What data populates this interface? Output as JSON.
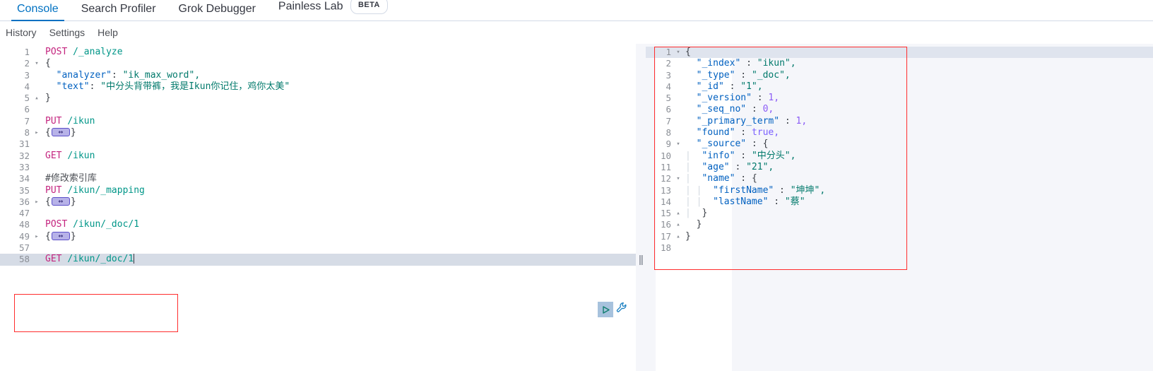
{
  "tabs": [
    {
      "label": "Console",
      "active": true,
      "badge": null
    },
    {
      "label": "Search Profiler",
      "active": false,
      "badge": null
    },
    {
      "label": "Grok Debugger",
      "active": false,
      "badge": null
    },
    {
      "label": "Painless Lab",
      "active": false,
      "badge": "BETA"
    }
  ],
  "subnav": [
    {
      "label": "History"
    },
    {
      "label": "Settings"
    },
    {
      "label": "Help"
    }
  ],
  "actions": {
    "run_icon": "play-triangle-icon",
    "wrench_icon": "wrench-icon",
    "splitter_grip": "||"
  },
  "colors": {
    "accent": "#0071c2",
    "annotation": "#ff2d2d",
    "method": "#c4257f",
    "url": "#009688",
    "key": "#0060c0",
    "string": "#00796b",
    "number": "#8b5cf6",
    "boolean": "#7b61ff"
  },
  "request_editor": {
    "lines": [
      {
        "num": "1",
        "fold": "",
        "highlight": false
      },
      {
        "num": "2",
        "fold": "▾",
        "highlight": false
      },
      {
        "num": "3",
        "fold": "",
        "highlight": false
      },
      {
        "num": "4",
        "fold": "",
        "highlight": false
      },
      {
        "num": "5",
        "fold": "▴",
        "highlight": false
      },
      {
        "num": "6",
        "fold": "",
        "highlight": false
      },
      {
        "num": "7",
        "fold": "",
        "highlight": false
      },
      {
        "num": "8",
        "fold": "▸",
        "highlight": false
      },
      {
        "num": "31",
        "fold": "",
        "highlight": false
      },
      {
        "num": "32",
        "fold": "",
        "highlight": false
      },
      {
        "num": "33",
        "fold": "",
        "highlight": false
      },
      {
        "num": "34",
        "fold": "",
        "highlight": false
      },
      {
        "num": "35",
        "fold": "",
        "highlight": false
      },
      {
        "num": "36",
        "fold": "▸",
        "highlight": false
      },
      {
        "num": "47",
        "fold": "",
        "highlight": false
      },
      {
        "num": "48",
        "fold": "",
        "highlight": false
      },
      {
        "num": "49",
        "fold": "▸",
        "highlight": false
      },
      {
        "num": "57",
        "fold": "",
        "highlight": false
      },
      {
        "num": "58",
        "fold": "",
        "highlight": true
      }
    ],
    "text": {
      "l1_method": "POST",
      "l1_url": "/_analyze",
      "l2": "{",
      "l3_key": "\"analyzer\"",
      "l3_sep": ": ",
      "l3_val": "\"ik_max_word\",",
      "l4_key": "\"text\"",
      "l4_sep": ": ",
      "l4_val": "\"中分头背带裤，我是Ikun你记住，鸡你太美\"",
      "l5": "}",
      "l7_method": "PUT",
      "l7_url": "/ikun",
      "l8_open": "{",
      "l8_close": "}",
      "l32_method": "GET",
      "l32_url": "/ikun",
      "l34_comment": "#修改索引库",
      "l35_method": "PUT",
      "l35_url": "/ikun/_mapping",
      "l36_open": "{",
      "l36_close": "}",
      "l48_method": "POST",
      "l48_url": "/ikun/_doc/1",
      "l49_open": "{",
      "l49_close": "}",
      "l58_method": "GET",
      "l58_url": "/ikun/_doc/1"
    }
  },
  "response_editor": {
    "lines": [
      {
        "num": "1",
        "fold": "▾"
      },
      {
        "num": "2",
        "fold": ""
      },
      {
        "num": "3",
        "fold": ""
      },
      {
        "num": "4",
        "fold": ""
      },
      {
        "num": "5",
        "fold": ""
      },
      {
        "num": "6",
        "fold": ""
      },
      {
        "num": "7",
        "fold": ""
      },
      {
        "num": "8",
        "fold": ""
      },
      {
        "num": "9",
        "fold": "▾"
      },
      {
        "num": "10",
        "fold": ""
      },
      {
        "num": "11",
        "fold": ""
      },
      {
        "num": "12",
        "fold": "▾"
      },
      {
        "num": "13",
        "fold": ""
      },
      {
        "num": "14",
        "fold": ""
      },
      {
        "num": "15",
        "fold": "▴"
      },
      {
        "num": "16",
        "fold": "▴"
      },
      {
        "num": "17",
        "fold": "▴"
      },
      {
        "num": "18",
        "fold": ""
      }
    ],
    "text": {
      "l1": "{",
      "l2_key": "\"_index\"",
      "l2_sep": " : ",
      "l2_val": "\"ikun\",",
      "l3_key": "\"_type\"",
      "l3_sep": " : ",
      "l3_val": "\"_doc\",",
      "l4_key": "\"_id\"",
      "l4_sep": " : ",
      "l4_val": "\"1\",",
      "l5_key": "\"_version\"",
      "l5_sep": " : ",
      "l5_val": "1,",
      "l6_key": "\"_seq_no\"",
      "l6_sep": " : ",
      "l6_val": "0,",
      "l7_key": "\"_primary_term\"",
      "l7_sep": " : ",
      "l7_val": "1,",
      "l8_key": "\"found\"",
      "l8_sep": " : ",
      "l8_val": "true,",
      "l9_key": "\"_source\"",
      "l9_sep": " : ",
      "l9_val": "{",
      "l10_key": "\"info\"",
      "l10_sep": " : ",
      "l10_val": "\"中分头\",",
      "l11_key": "\"age\"",
      "l11_sep": " : ",
      "l11_val": "\"21\",",
      "l12_key": "\"name\"",
      "l12_sep": " : ",
      "l12_val": "{",
      "l13_key": "\"firstName\"",
      "l13_sep": " : ",
      "l13_val": "\"坤坤\",",
      "l14_key": "\"lastName\"",
      "l14_sep": " : ",
      "l14_val": "\"蔡\"",
      "l15": "}",
      "l16": "}",
      "l17": "}"
    }
  }
}
